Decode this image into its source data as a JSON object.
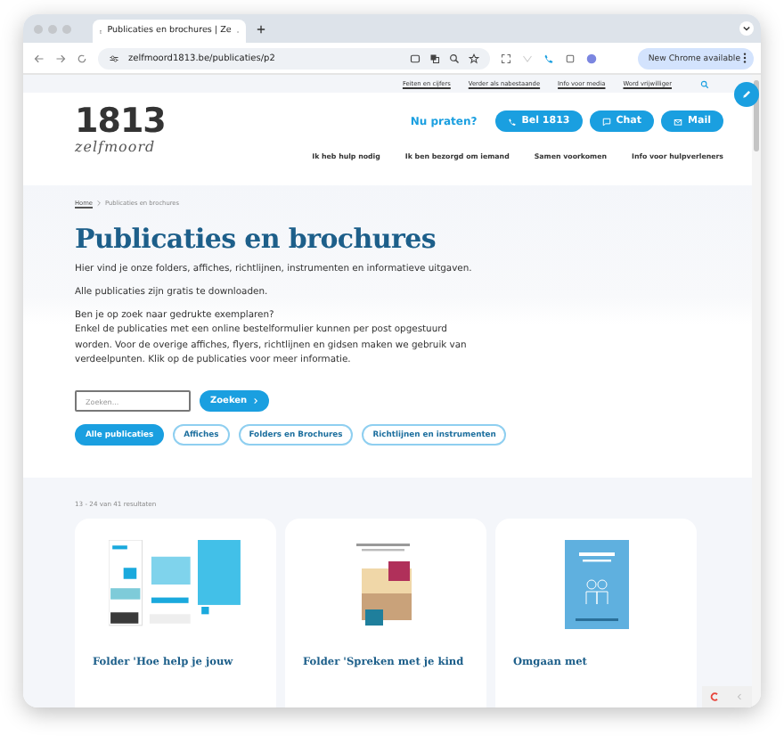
{
  "browser": {
    "tab_title": "Publicaties en brochures | Ze",
    "url": "zelfmoord1813.be/publicaties/p2",
    "update_button": "New Chrome available"
  },
  "top_links": [
    "Feiten en cijfers",
    "Verder als nabestaande",
    "Info voor media",
    "Word vrijwilliger"
  ],
  "header": {
    "logo_number": "1813",
    "logo_word": "zelfmoord",
    "prompt": "Nu praten?",
    "contact_buttons": [
      {
        "label": "Bel 1813",
        "kind": "phone"
      },
      {
        "label": "Chat",
        "kind": "chat"
      },
      {
        "label": "Mail",
        "kind": "mail"
      }
    ],
    "nav": [
      "Ik heb hulp nodig",
      "Ik ben bezorgd om iemand",
      "Samen voorkomen",
      "Info voor hulpverleners"
    ]
  },
  "breadcrumb": [
    "Home",
    "Publicaties en brochures"
  ],
  "title": "Publicaties en brochures",
  "paragraphs": [
    {
      "lines": [
        "Hier vind je onze folders, affiches, richtlijnen, instrumenten en informatieve uitgaven."
      ]
    },
    {
      "lines": [
        "Alle publicaties zijn gratis te downloaden."
      ]
    },
    {
      "lines": [
        "Ben je op zoek naar gedrukte exemplaren?",
        "Enkel de publicaties met een online bestelformulier kunnen per post opgestuurd worden. Voor de overige affiches, flyers, richtlijnen en gidsen maken we gebruik van verdeelpunten. Klik op de publicaties voor meer informatie."
      ]
    }
  ],
  "search": {
    "placeholder": "Zoeken...",
    "button": "Zoeken"
  },
  "filters": [
    {
      "label": "Alle publicaties",
      "selected": true
    },
    {
      "label": "Affiches",
      "selected": false
    },
    {
      "label": "Folders en Brochures",
      "selected": false
    },
    {
      "label": "Richtlijnen en instrumenten",
      "selected": false
    }
  ],
  "results_count": "13 - 24 van 41 resultaten",
  "cards": [
    {
      "title": "Folder 'Hoe help je jouw",
      "kind": "collage"
    },
    {
      "title": "Folder 'Spreken met je kind",
      "kind": "photo"
    },
    {
      "title": "Omgaan met",
      "kind": "cover"
    }
  ]
}
